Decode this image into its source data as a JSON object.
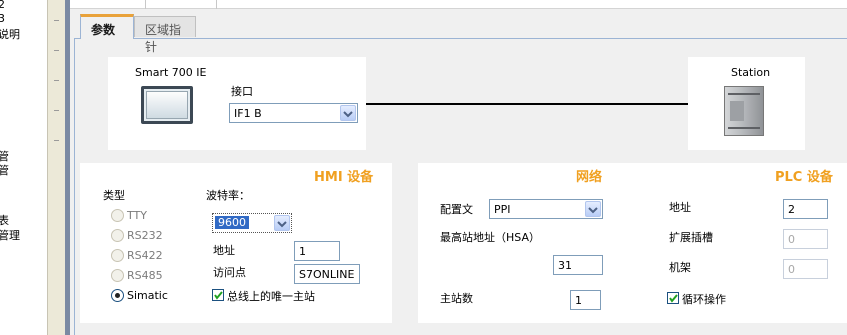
{
  "left_pane": {
    "fragments": [
      "2",
      "3",
      "说明",
      "管",
      "管",
      "表",
      "管理"
    ]
  },
  "tabs": {
    "params_label": "参数",
    "area_pointer_label": "区域指针"
  },
  "connection": {
    "hmi_device_name": "Smart 700 IE",
    "interface_label": "接口",
    "interface_value": "IF1 B",
    "plc_device_name": "Station"
  },
  "hmi_section": {
    "title": "HMI 设备",
    "type_label": "类型",
    "types": [
      {
        "label": "TTY",
        "selected": false
      },
      {
        "label": "RS232",
        "selected": false
      },
      {
        "label": "RS422",
        "selected": false
      },
      {
        "label": "RS485",
        "selected": false
      },
      {
        "label": "Simatic",
        "selected": true
      }
    ],
    "baud_label": "波特率：",
    "baud_value": "9600",
    "address_label": "地址",
    "address_value": "1",
    "access_point_label": "访问点",
    "access_point_value": "S7ONLINE",
    "only_master_label": "总线上的唯一主站",
    "only_master_checked": true
  },
  "network_section": {
    "title": "网络",
    "profile_label": "配置文",
    "profile_value": "PPI",
    "hsa_label": "最高站地址（HSA）",
    "hsa_value": "31",
    "master_count_label": "主站数",
    "master_count_value": "1"
  },
  "plc_section": {
    "title": "PLC 设备",
    "address_label": "地址",
    "address_value": "2",
    "expansion_slot_label": "扩展插槽",
    "expansion_slot_value": "0",
    "rack_label": "机架",
    "rack_value": "0",
    "cyclic_label": "循环操作",
    "cyclic_checked": true
  },
  "colors": {
    "section_title": "#f0a020",
    "tab_accent": "#e9a23a",
    "panel_bg": "#f0f0f0",
    "selection": "#316ac5"
  }
}
